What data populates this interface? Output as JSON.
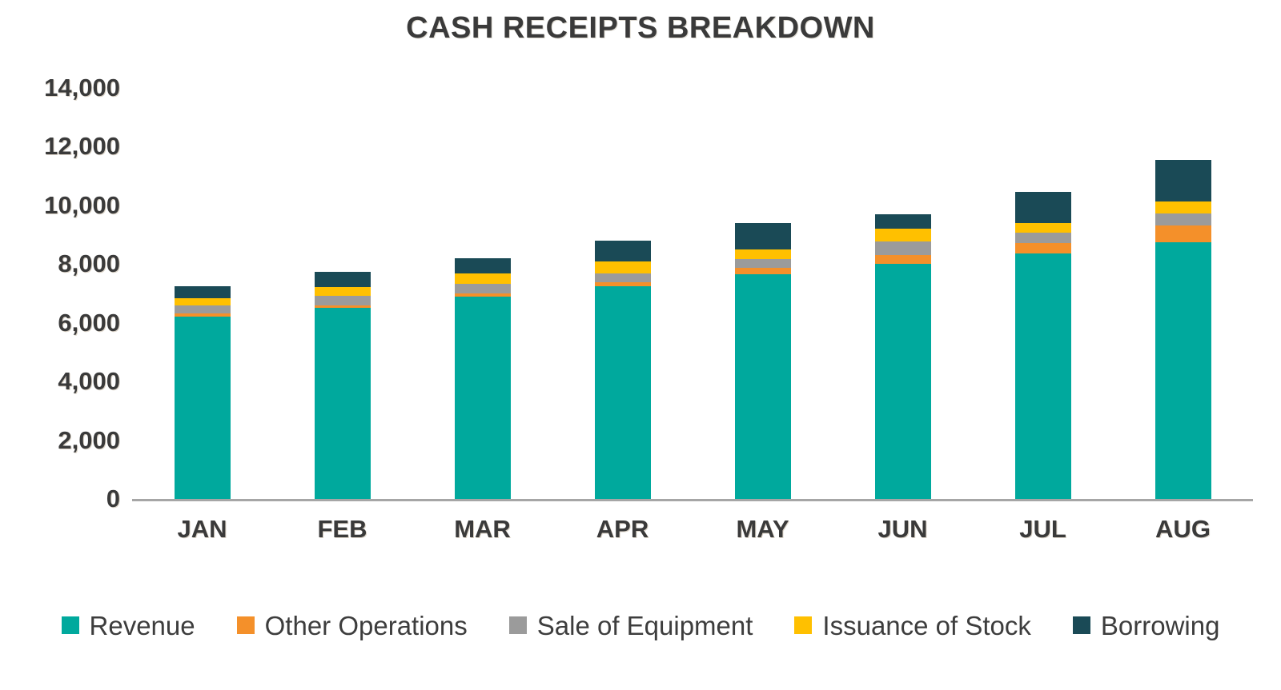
{
  "chart_data": {
    "type": "bar",
    "stacked": true,
    "title": "CASH RECEIPTS BREAKDOWN",
    "xlabel": "",
    "ylabel": "",
    "ylim": [
      0,
      14000
    ],
    "ytick_labels": [
      "14,000",
      "12,000",
      "10,000",
      "8,000",
      "6,000",
      "4,000",
      "2,000",
      "0"
    ],
    "ytick_values": [
      14000,
      12000,
      10000,
      8000,
      6000,
      4000,
      2000,
      0
    ],
    "grid": false,
    "legend_position": "bottom",
    "categories": [
      "JAN",
      "FEB",
      "MAR",
      "APR",
      "MAY",
      "JUN",
      "JUL",
      "AUG"
    ],
    "series": [
      {
        "name": "Revenue",
        "color": "#00A99D",
        "values": [
          6200,
          6500,
          6900,
          7250,
          7650,
          8000,
          8350,
          8750
        ]
      },
      {
        "name": "Other Operations",
        "color": "#F4902A",
        "values": [
          110,
          90,
          110,
          140,
          220,
          320,
          360,
          560
        ]
      },
      {
        "name": "Sale of Equipment",
        "color": "#9B9B9B",
        "values": [
          290,
          330,
          330,
          300,
          300,
          440,
          350,
          410
        ]
      },
      {
        "name": "Issuance of Stock",
        "color": "#FFC000",
        "values": [
          250,
          300,
          330,
          410,
          330,
          440,
          350,
          410
        ]
      },
      {
        "name": "Borrowing",
        "color": "#1A4A56",
        "values": [
          400,
          530,
          530,
          700,
          900,
          500,
          1040,
          1420
        ]
      }
    ],
    "totals": [
      7250,
      7750,
      8200,
      8800,
      9400,
      9700,
      10450,
      11550
    ]
  }
}
